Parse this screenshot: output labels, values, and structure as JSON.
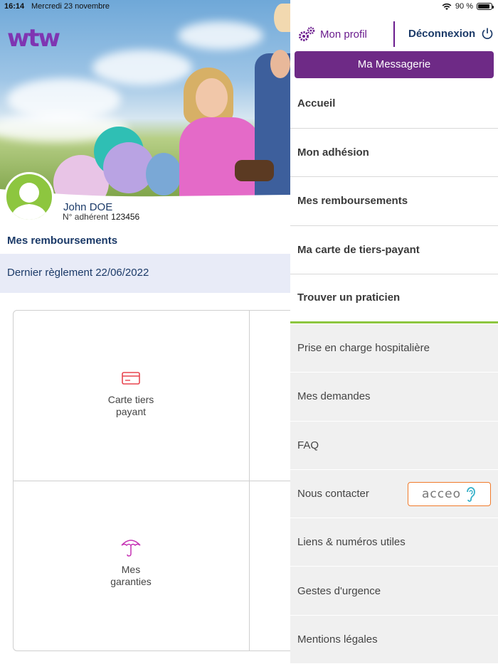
{
  "statusbar": {
    "time": "16:14",
    "date": "Mercredi 23 novembre",
    "battery": "90 %",
    "battery_level": 0.9
  },
  "brand": {
    "logo": "wtw",
    "accent": "#6e2a86",
    "green": "#8dc63f"
  },
  "user": {
    "name": "John DOE",
    "member_label": "N° adhérent",
    "member_number": "123456"
  },
  "main": {
    "section_title": "Mes remboursements",
    "last_payment": "Dernier règlement 22/06/2022",
    "tiles": [
      {
        "label_line1": "Carte tiers",
        "label_line2": "payant",
        "icon": "card-icon"
      },
      {
        "label_line1": "Mes",
        "label_line2": "garanties",
        "icon": "umbrella-icon"
      }
    ]
  },
  "drawer": {
    "profile": "Mon profil",
    "logout": "Déconnexion",
    "messaging": "Ma Messagerie",
    "primary_items": [
      "Accueil",
      "Mon adhésion",
      "Mes remboursements",
      "Ma carte de tiers-payant",
      "Trouver un praticien"
    ],
    "secondary_items": [
      "Prise en charge hospitalière",
      "Mes demandes",
      "FAQ",
      "Nous contacter",
      "Liens & numéros utiles",
      "Gestes d'urgence",
      "Mentions légales"
    ],
    "acceo_label": "acceo"
  }
}
